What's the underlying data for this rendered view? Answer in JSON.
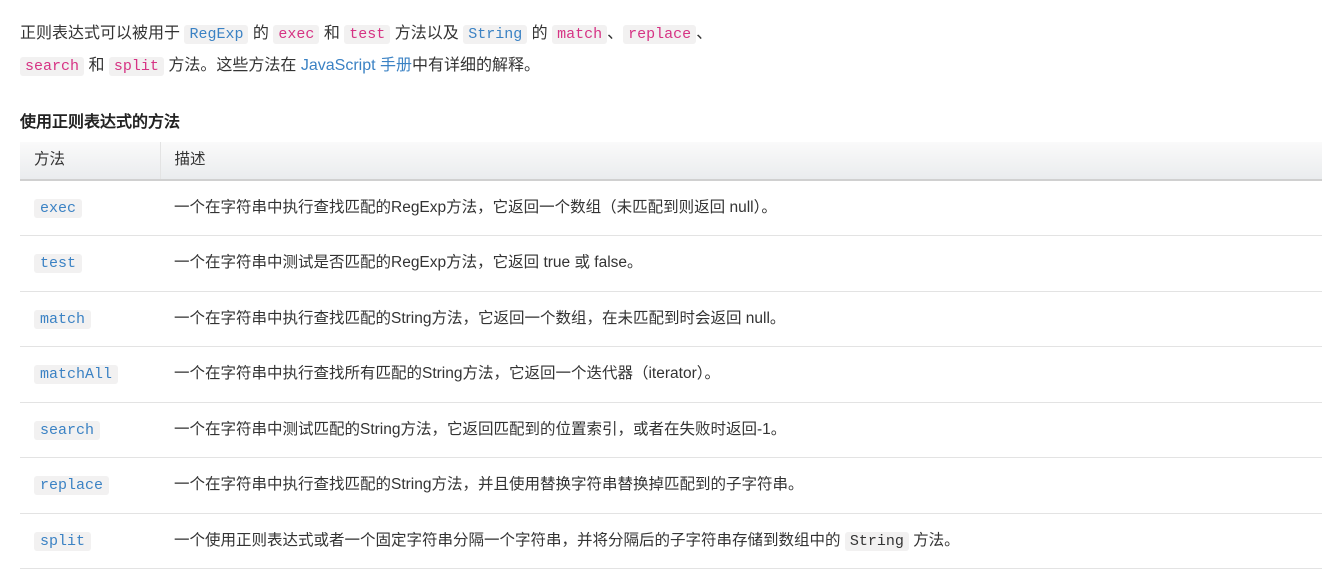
{
  "intro": {
    "t1": "正则表达式可以被用于 ",
    "c1": "RegExp",
    "t2": " 的 ",
    "c2": "exec",
    "t3": " 和 ",
    "c3": "test",
    "t4": " 方法以及 ",
    "c4": "String",
    "t5": " 的 ",
    "c5": "match",
    "t6": "、",
    "c6": "replace",
    "t7": "、",
    "c7": "search",
    "t8": " 和 ",
    "c8": "split",
    "t9": " 方法。这些方法在 ",
    "link": "JavaScript 手册",
    "t10": "中有详细的解释。"
  },
  "caption": "使用正则表达式的方法",
  "headers": {
    "method": "方法",
    "desc": "描述"
  },
  "rows": [
    {
      "method": "exec",
      "desc": "一个在字符串中执行查找匹配的RegExp方法，它返回一个数组（未匹配到则返回 null）。"
    },
    {
      "method": "test",
      "desc": "一个在字符串中测试是否匹配的RegExp方法，它返回 true 或 false。"
    },
    {
      "method": "match",
      "desc": "一个在字符串中执行查找匹配的String方法，它返回一个数组，在未匹配到时会返回 null。"
    },
    {
      "method": "matchAll",
      "desc": "一个在字符串中执行查找所有匹配的String方法，它返回一个迭代器（iterator）。"
    },
    {
      "method": "search",
      "desc": "一个在字符串中测试匹配的String方法，它返回匹配到的位置索引，或者在失败时返回-1。"
    },
    {
      "method": "replace",
      "desc": "一个在字符串中执行查找匹配的String方法，并且使用替换字符串替换掉匹配到的子字符串。"
    }
  ],
  "lastRow": {
    "method": "split",
    "descPre": "一个使用正则表达式或者一个固定字符串分隔一个字符串，并将分隔后的子字符串存储到数组中的 ",
    "descCode": "String",
    "descPost": " 方法。"
  }
}
